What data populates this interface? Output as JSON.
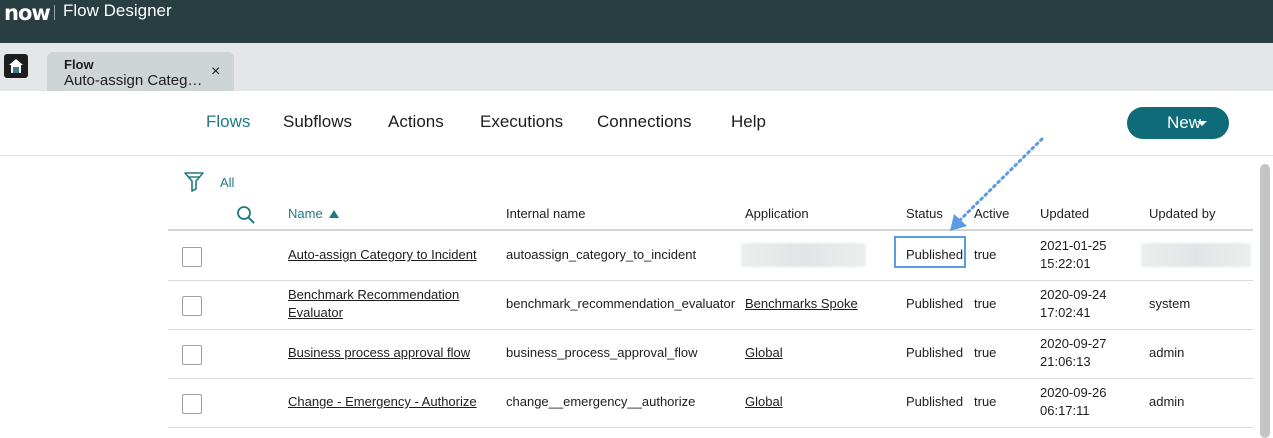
{
  "topbar": {
    "logo": "now",
    "title": "Flow Designer"
  },
  "tab": {
    "type": "Flow",
    "name": "Auto-assign Categ…",
    "close_glyph": "×"
  },
  "nav": {
    "items": [
      "Flows",
      "Subflows",
      "Actions",
      "Executions",
      "Connections",
      "Help"
    ],
    "active": "Flows"
  },
  "new_button": {
    "label": "New"
  },
  "filter": {
    "label": "All"
  },
  "table": {
    "columns": {
      "name": "Name",
      "internal_name": "Internal name",
      "application": "Application",
      "status": "Status",
      "active": "Active",
      "updated": "Updated",
      "updated_by": "Updated by"
    },
    "sort": {
      "column": "Name",
      "direction": "ascending"
    },
    "rows": [
      {
        "name_line1": "Auto-assign Category to Incident",
        "name_line2": "",
        "internal_name": "autoassign_category_to_incident",
        "application": "",
        "status": "Published",
        "active": "true",
        "updated_date": "2021-01-25",
        "updated_time": "15:22:01",
        "updated_by": ""
      },
      {
        "name_line1": "Benchmark Recommendation",
        "name_line2": "Evaluator",
        "internal_name": "benchmark_recommendation_evaluator",
        "application": "Benchmarks Spoke",
        "status": "Published",
        "active": "true",
        "updated_date": "2020-09-24",
        "updated_time": "17:02:41",
        "updated_by": "system"
      },
      {
        "name_line1": "Business process approval flow",
        "name_line2": "",
        "internal_name": "business_process_approval_flow",
        "application": "Global",
        "status": "Published",
        "active": "true",
        "updated_date": "2020-09-27",
        "updated_time": "21:06:13",
        "updated_by": "admin"
      },
      {
        "name_line1": "Change - Emergency - Authorize",
        "name_line2": "",
        "internal_name": "change__emergency__authorize",
        "application": "Global",
        "status": "Published",
        "active": "true",
        "updated_date": "2020-09-26",
        "updated_time": "06:17:11",
        "updated_by": "admin"
      }
    ]
  },
  "colors": {
    "topbar": "#293e40",
    "accent": "#1f7b7e",
    "new_button": "#0e6b77",
    "highlight": "#5b9be0"
  }
}
